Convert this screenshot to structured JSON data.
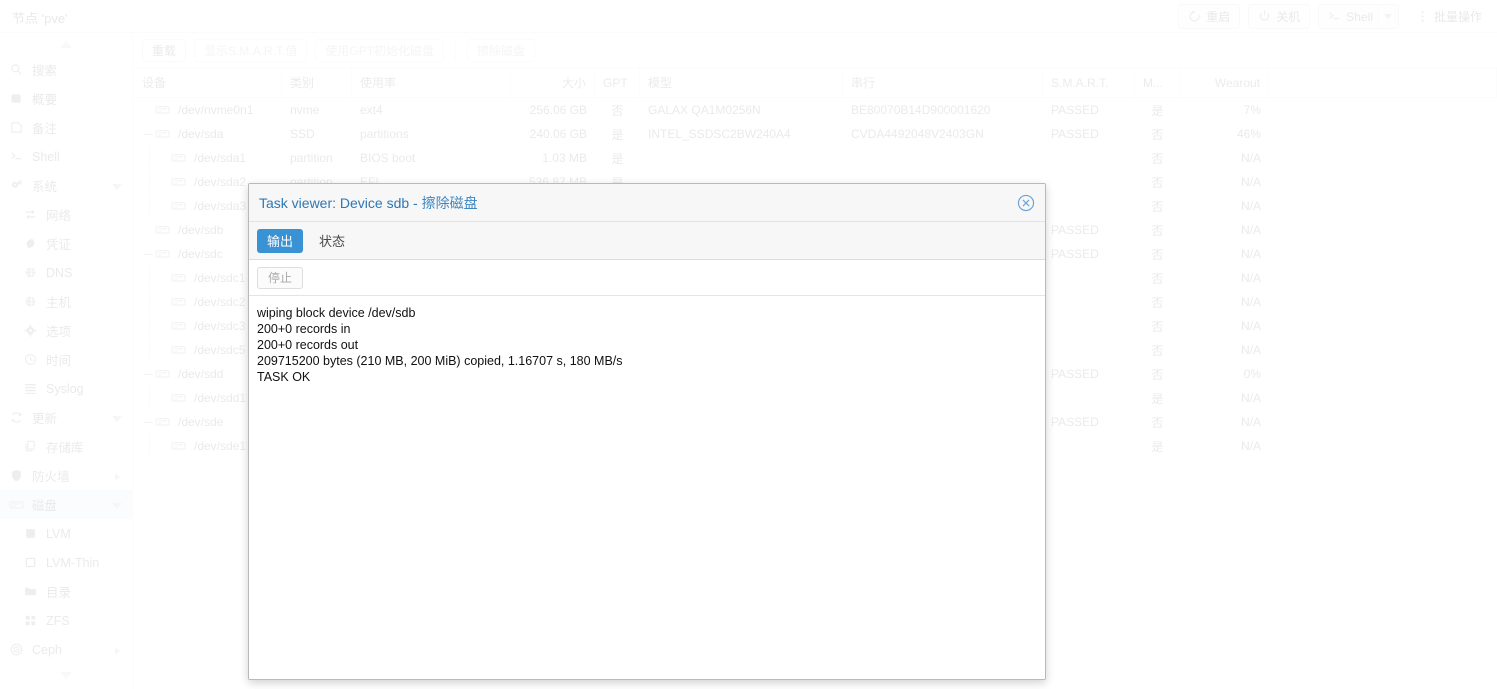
{
  "header": {
    "node_title": "节点 'pve'",
    "actions": [
      {
        "name": "restart-button",
        "label": "重启",
        "icon": "restart-icon"
      },
      {
        "name": "shutdown-button",
        "label": "关机",
        "icon": "power-icon"
      },
      {
        "name": "shell-button",
        "label": "Shell",
        "icon": "console-icon",
        "split": true
      },
      {
        "name": "bulk-actions-button",
        "label": "批量操作",
        "icon": "kebab-icon"
      }
    ]
  },
  "sidebar": {
    "items": [
      {
        "label": "搜索",
        "icon": "search-icon",
        "level": 0,
        "selected": false
      },
      {
        "label": "概要",
        "icon": "summary-icon",
        "level": 0,
        "selected": false
      },
      {
        "label": "备注",
        "icon": "notes-icon",
        "level": 0,
        "selected": false
      },
      {
        "label": "Shell",
        "icon": "console-icon",
        "level": 0,
        "selected": false
      },
      {
        "label": "系统",
        "icon": "gears-icon",
        "level": 0,
        "selected": false,
        "expanded": true
      },
      {
        "label": "网络",
        "icon": "network-icon",
        "level": 1,
        "selected": false
      },
      {
        "label": "凭证",
        "icon": "certificate-icon",
        "level": 1,
        "selected": false
      },
      {
        "label": "DNS",
        "icon": "globe-icon",
        "level": 1,
        "selected": false
      },
      {
        "label": "主机",
        "icon": "globe-icon",
        "level": 1,
        "selected": false
      },
      {
        "label": "选项",
        "icon": "gear-icon",
        "level": 1,
        "selected": false
      },
      {
        "label": "时间",
        "icon": "clock-icon",
        "level": 1,
        "selected": false
      },
      {
        "label": "Syslog",
        "icon": "list-icon",
        "level": 1,
        "selected": false
      },
      {
        "label": "更新",
        "icon": "refresh-icon",
        "level": 0,
        "selected": false,
        "expanded": true
      },
      {
        "label": "存储库",
        "icon": "repository-icon",
        "level": 1,
        "selected": false
      },
      {
        "label": "防火墙",
        "icon": "shield-icon",
        "level": 0,
        "selected": false,
        "collapsed": true
      },
      {
        "label": "磁盘",
        "icon": "disk-icon",
        "level": 0,
        "selected": true,
        "expanded": true
      },
      {
        "label": "LVM",
        "icon": "lvm-icon",
        "level": 1,
        "selected": false
      },
      {
        "label": "LVM-Thin",
        "icon": "lvmthin-icon",
        "level": 1,
        "selected": false
      },
      {
        "label": "目录",
        "icon": "folder-icon",
        "level": 1,
        "selected": false
      },
      {
        "label": "ZFS",
        "icon": "zfs-icon",
        "level": 1,
        "selected": false
      },
      {
        "label": "Ceph",
        "icon": "ceph-icon",
        "level": 0,
        "selected": false,
        "collapsed": true
      }
    ]
  },
  "toolbar": {
    "buttons": [
      {
        "name": "reload-button",
        "label": "重载",
        "disabled": false
      },
      {
        "name": "show-smart-button",
        "label": "显示S.M.A.R.T.值",
        "disabled": true
      },
      {
        "name": "init-gpt-button",
        "label": "使用GPT初始化磁盘",
        "disabled": true
      },
      {
        "name": "wipe-disk-button",
        "label": "擦除磁盘",
        "disabled": true
      }
    ]
  },
  "grid": {
    "columns": [
      {
        "key": "device",
        "label": "设备"
      },
      {
        "key": "type",
        "label": "类别"
      },
      {
        "key": "usage",
        "label": "使用率"
      },
      {
        "key": "size",
        "label": "大小"
      },
      {
        "key": "gpt",
        "label": "GPT"
      },
      {
        "key": "model",
        "label": "模型"
      },
      {
        "key": "serial",
        "label": "串行"
      },
      {
        "key": "smart",
        "label": "S.M.A.R.T."
      },
      {
        "key": "mounted",
        "label": "M..."
      },
      {
        "key": "wearout",
        "label": "Wearout"
      }
    ],
    "rows": [
      {
        "device": "/dev/nvme0n1",
        "depth": 0,
        "expander": "none",
        "type": "nvme",
        "usage": "ext4",
        "size": "256.06 GB",
        "gpt": "否",
        "model": "GALAX QA1M0256N",
        "serial": "BE80070B14D900001620",
        "smart": "PASSED",
        "mounted": "是",
        "wearout": "7%"
      },
      {
        "device": "/dev/sda",
        "depth": 0,
        "expander": "minus",
        "type": "SSD",
        "usage": "partitions",
        "size": "240.06 GB",
        "gpt": "是",
        "model": "INTEL_SSDSC2BW240A4",
        "serial": "CVDA4492048V2403GN",
        "smart": "PASSED",
        "mounted": "否",
        "wearout": "46%"
      },
      {
        "device": "/dev/sda1",
        "depth": 1,
        "expander": "none",
        "type": "partition",
        "usage": "BIOS boot",
        "size": "1.03 MB",
        "gpt": "是",
        "model": "",
        "serial": "",
        "smart": "",
        "mounted": "否",
        "wearout": "N/A"
      },
      {
        "device": "/dev/sda2",
        "depth": 1,
        "expander": "none",
        "type": "partition",
        "usage": "EFI",
        "size": "536.87 MB",
        "gpt": "是",
        "model": "",
        "serial": "",
        "smart": "",
        "mounted": "否",
        "wearout": "N/A"
      },
      {
        "device": "/dev/sda3",
        "depth": 1,
        "expander": "none",
        "type": "partition",
        "usage": "",
        "size": "",
        "gpt": "",
        "model": "",
        "serial": "",
        "smart": "",
        "mounted": "否",
        "wearout": "N/A"
      },
      {
        "device": "/dev/sdb",
        "depth": 0,
        "expander": "none",
        "type": "",
        "usage": "",
        "size": "",
        "gpt": "",
        "model": "",
        "serial": "",
        "smart": "PASSED",
        "mounted": "否",
        "wearout": "N/A"
      },
      {
        "device": "/dev/sdc",
        "depth": 0,
        "expander": "minus",
        "type": "",
        "usage": "",
        "size": "",
        "gpt": "",
        "model": "",
        "serial": "",
        "smart": "PASSED",
        "mounted": "否",
        "wearout": "N/A"
      },
      {
        "device": "/dev/sdc1",
        "depth": 1,
        "expander": "none",
        "type": "",
        "usage": "",
        "size": "",
        "gpt": "",
        "model": "",
        "serial": "",
        "smart": "",
        "mounted": "否",
        "wearout": "N/A"
      },
      {
        "device": "/dev/sdc2",
        "depth": 1,
        "expander": "none",
        "type": "",
        "usage": "",
        "size": "",
        "gpt": "",
        "model": "",
        "serial": "",
        "smart": "",
        "mounted": "否",
        "wearout": "N/A"
      },
      {
        "device": "/dev/sdc3",
        "depth": 1,
        "expander": "none",
        "type": "",
        "usage": "",
        "size": "",
        "gpt": "",
        "model": "",
        "serial": "",
        "smart": "",
        "mounted": "否",
        "wearout": "N/A"
      },
      {
        "device": "/dev/sdc5",
        "depth": 1,
        "expander": "none",
        "type": "",
        "usage": "",
        "size": "",
        "gpt": "",
        "model": "",
        "serial": "",
        "smart": "",
        "mounted": "否",
        "wearout": "N/A"
      },
      {
        "device": "/dev/sdd",
        "depth": 0,
        "expander": "minus",
        "type": "",
        "usage": "",
        "size": "",
        "gpt": "",
        "model": "",
        "serial": "",
        "smart": "PASSED",
        "mounted": "否",
        "wearout": "0%"
      },
      {
        "device": "/dev/sdd1",
        "depth": 1,
        "expander": "none",
        "type": "",
        "usage": "",
        "size": "",
        "gpt": "",
        "model": "",
        "serial": "",
        "smart": "",
        "mounted": "是",
        "wearout": "N/A"
      },
      {
        "device": "/dev/sde",
        "depth": 0,
        "expander": "minus",
        "type": "",
        "usage": "",
        "size": "",
        "gpt": "",
        "model": "",
        "serial": "",
        "smart": "PASSED",
        "mounted": "否",
        "wearout": "N/A"
      },
      {
        "device": "/dev/sde1",
        "depth": 1,
        "expander": "none",
        "type": "",
        "usage": "",
        "size": "",
        "gpt": "",
        "model": "",
        "serial": "",
        "smart": "",
        "mounted": "是",
        "wearout": "N/A"
      }
    ]
  },
  "dialog": {
    "title_main": "Task viewer: Device sdb - ",
    "title_sub": "擦除磁盘",
    "close_icon": "close-circle-icon",
    "tabs": [
      {
        "label": "输出",
        "active": true
      },
      {
        "label": "状态",
        "active": false
      }
    ],
    "stop_label": "停止",
    "log": [
      "wiping block device /dev/sdb",
      "200+0 records in",
      "200+0 records out",
      "209715200 bytes (210 MB, 200 MiB) copied, 1.16707 s, 180 MB/s",
      "TASK OK"
    ]
  },
  "colors": {
    "accent_blue": "#3892d4",
    "title_blue": "#2e77b4",
    "sidebar_selected": "#dfeaf6"
  }
}
